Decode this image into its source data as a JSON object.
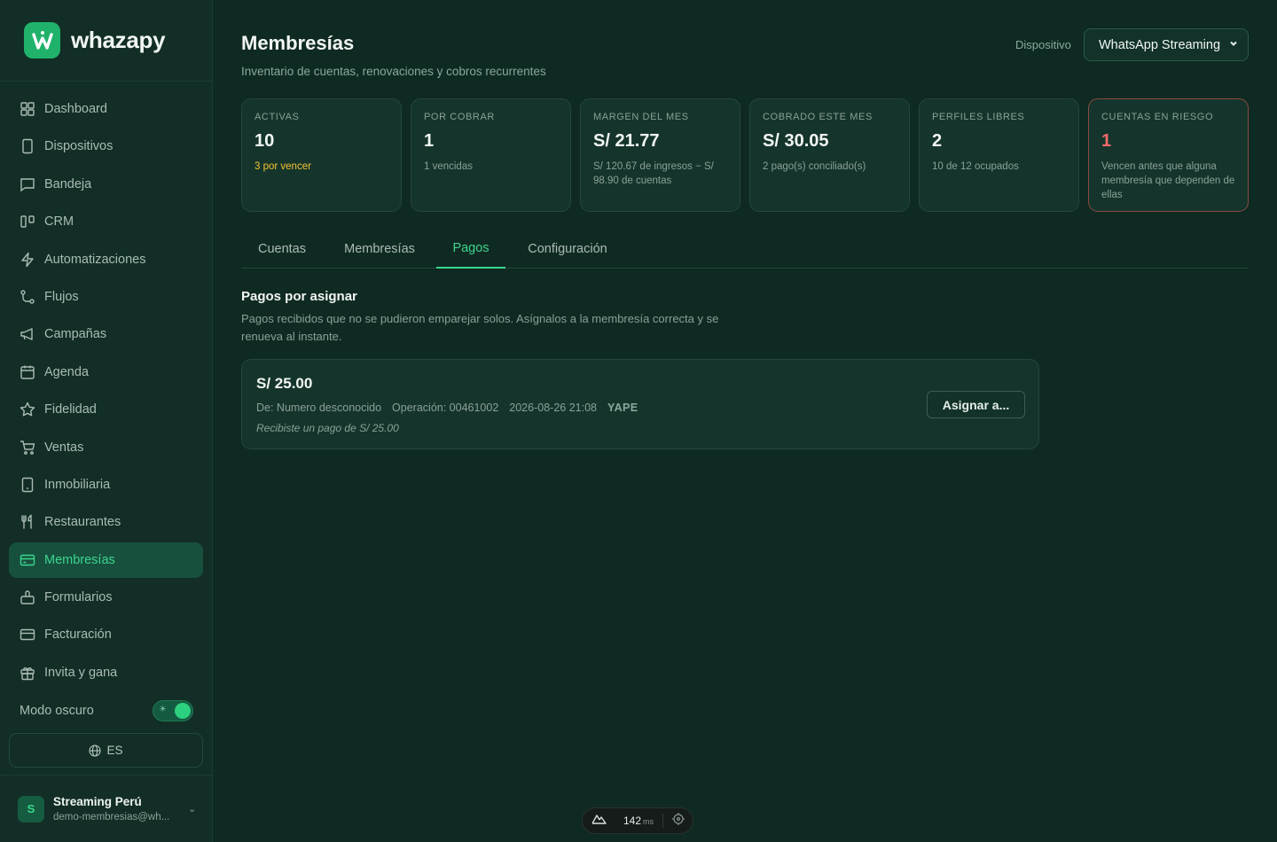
{
  "brand": {
    "name": "whazapy"
  },
  "sidebar": {
    "items": [
      {
        "label": "Dashboard",
        "icon": "grid-icon"
      },
      {
        "label": "Dispositivos",
        "icon": "device-icon"
      },
      {
        "label": "Bandeja",
        "icon": "message-icon"
      },
      {
        "label": "CRM",
        "icon": "kanban-icon"
      },
      {
        "label": "Automatizaciones",
        "icon": "zap-icon"
      },
      {
        "label": "Flujos",
        "icon": "flow-icon"
      },
      {
        "label": "Campañas",
        "icon": "megaphone-icon"
      },
      {
        "label": "Agenda",
        "icon": "calendar-icon"
      },
      {
        "label": "Fidelidad",
        "icon": "star-icon"
      },
      {
        "label": "Ventas",
        "icon": "cart-icon"
      },
      {
        "label": "Inmobiliaria",
        "icon": "building-icon"
      },
      {
        "label": "Restaurantes",
        "icon": "utensils-icon"
      },
      {
        "label": "Membresías",
        "icon": "card-icon",
        "active": true
      },
      {
        "label": "Formularios",
        "icon": "clipboard-icon"
      },
      {
        "label": "Facturación",
        "icon": "billing-icon"
      },
      {
        "label": "Invita y gana",
        "icon": "gift-icon"
      }
    ],
    "dark_mode_label": "Modo oscuro",
    "dark_mode_on": true,
    "language": "ES",
    "user": {
      "initial": "S",
      "name": "Streaming Perú",
      "email": "demo-membresias@wh..."
    }
  },
  "header": {
    "title": "Membresías",
    "subtitle": "Inventario de cuentas, renovaciones y cobros recurrentes",
    "device_label": "Dispositivo",
    "device_value": "WhatsApp Streaming"
  },
  "stats": [
    {
      "label": "ACTIVAS",
      "value": "10",
      "note": "3 por vencer"
    },
    {
      "label": "POR COBRAR",
      "value": "1",
      "note": "1 vencidas"
    },
    {
      "label": "MARGEN DEL MES",
      "value": "S/ 21.77",
      "note": "S/ 120.67 de ingresos − S/ 98.90 de cuentas"
    },
    {
      "label": "COBRADO ESTE MES",
      "value": "S/ 30.05",
      "note": "2 pago(s) conciliado(s)"
    },
    {
      "label": "PERFILES LIBRES",
      "value": "2",
      "note": "10 de 12 ocupados"
    },
    {
      "label": "CUENTAS EN RIESGO",
      "value": "1",
      "note": "Vencen antes que alguna membresía que dependen de ellas"
    }
  ],
  "tabs": [
    "Cuentas",
    "Membresías",
    "Pagos",
    "Configuración"
  ],
  "active_tab": "Pagos",
  "section": {
    "title": "Pagos por asignar",
    "description": "Pagos recibidos que no se pudieron emparejar solos. Asígnalos a la membresía correcta y se renueva al instante."
  },
  "payment": {
    "amount": "S/ 25.00",
    "from": "De: Numero desconocido",
    "operation": "Operación: 00461002",
    "datetime": "2026-08-26 21:08",
    "method": "YAPE",
    "message": "Recibiste un pago de S/ 25.00",
    "assign_label": "Asignar a..."
  },
  "devtools": {
    "ms": "142",
    "unit": "ms"
  },
  "colors": {
    "accent": "#3bd68e",
    "background": "#0f2a22",
    "warning": "#f4c431",
    "danger": "#f06a6a"
  }
}
